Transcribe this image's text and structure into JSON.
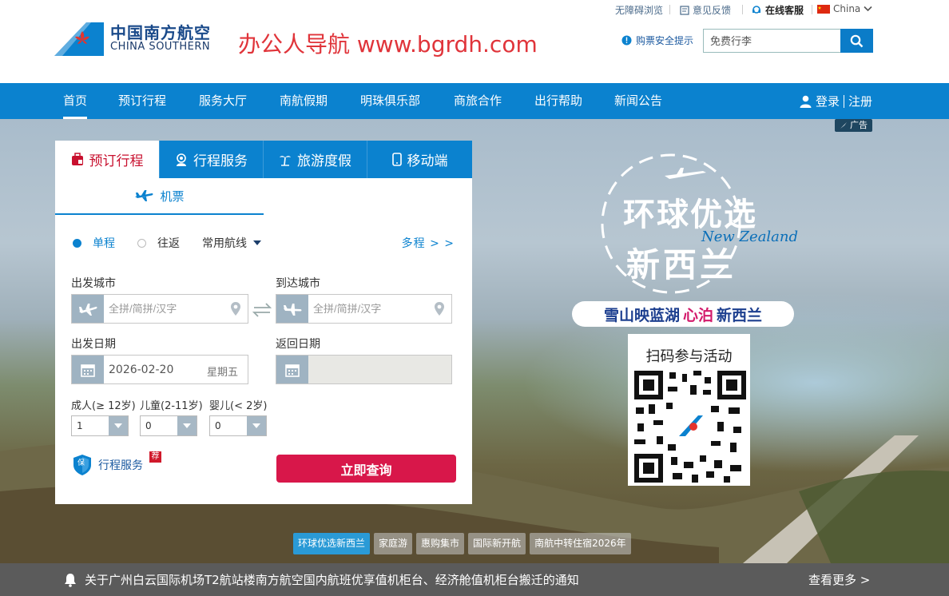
{
  "util": {
    "accessible": "无障碍浏览",
    "feedback": "意见反馈",
    "service": "在线客服",
    "region": "China"
  },
  "logo": {
    "cn": "中国南方航空",
    "en": "CHINA SOUTHERN"
  },
  "promo": "办公人导航  www.bgrdh.com",
  "header": {
    "safety_tip": "购票安全提示",
    "search_placeholder": "免费行李"
  },
  "nav": {
    "items": [
      "首页",
      "预订行程",
      "服务大厅",
      "南航假期",
      "明珠俱乐部",
      "商旅合作",
      "出行帮助",
      "新闻公告"
    ],
    "login": "登录",
    "register": "注册"
  },
  "ad_tag": "广告",
  "booking": {
    "tabs": [
      "预订行程",
      "行程服务",
      "旅游度假",
      "移动端"
    ],
    "subtab": "机票",
    "trip_one_way": "单程",
    "trip_round": "往返",
    "common_routes": "常用航线",
    "multi_city": "多程 > >",
    "from_label": "出发城市",
    "to_label": "到达城市",
    "city_placeholder": "全拼/简拼/汉字",
    "depart_label": "出发日期",
    "return_label": "返回日期",
    "depart_date": "2026-02-20",
    "depart_weekday": "星期五",
    "adult_label": "成人(≥ 12岁)",
    "child_label": "儿童(2-11岁)",
    "infant_label": "婴儿(< 2岁)",
    "adult_value": "1",
    "child_value": "0",
    "infant_value": "0",
    "service_link": "行程服务",
    "service_badge": "荐",
    "service_icon_char": "保",
    "submit": "立即查询"
  },
  "ad": {
    "line1": "环球优选",
    "line2": "新西兰",
    "nz": "New Zealand",
    "slogan_a": "雪山映蓝湖",
    "slogan_b": "心泊",
    "slogan_c": "新西兰",
    "qr_title": "扫码参与活动"
  },
  "chips": [
    "环球优选新西兰",
    "家庭游",
    "惠购集市",
    "国际新开航",
    "南航中转住宿2026年"
  ],
  "notice": {
    "text": "关于广州白云国际机场T2航站楼南方航空国内航班优享值机柜台、经济舱值机柜台搬迁的通知",
    "more": "查看更多 >"
  },
  "colors": {
    "brand_blue": "#0b82cf",
    "submit_red": "#d8174a",
    "promo_red": "#e0343a"
  }
}
